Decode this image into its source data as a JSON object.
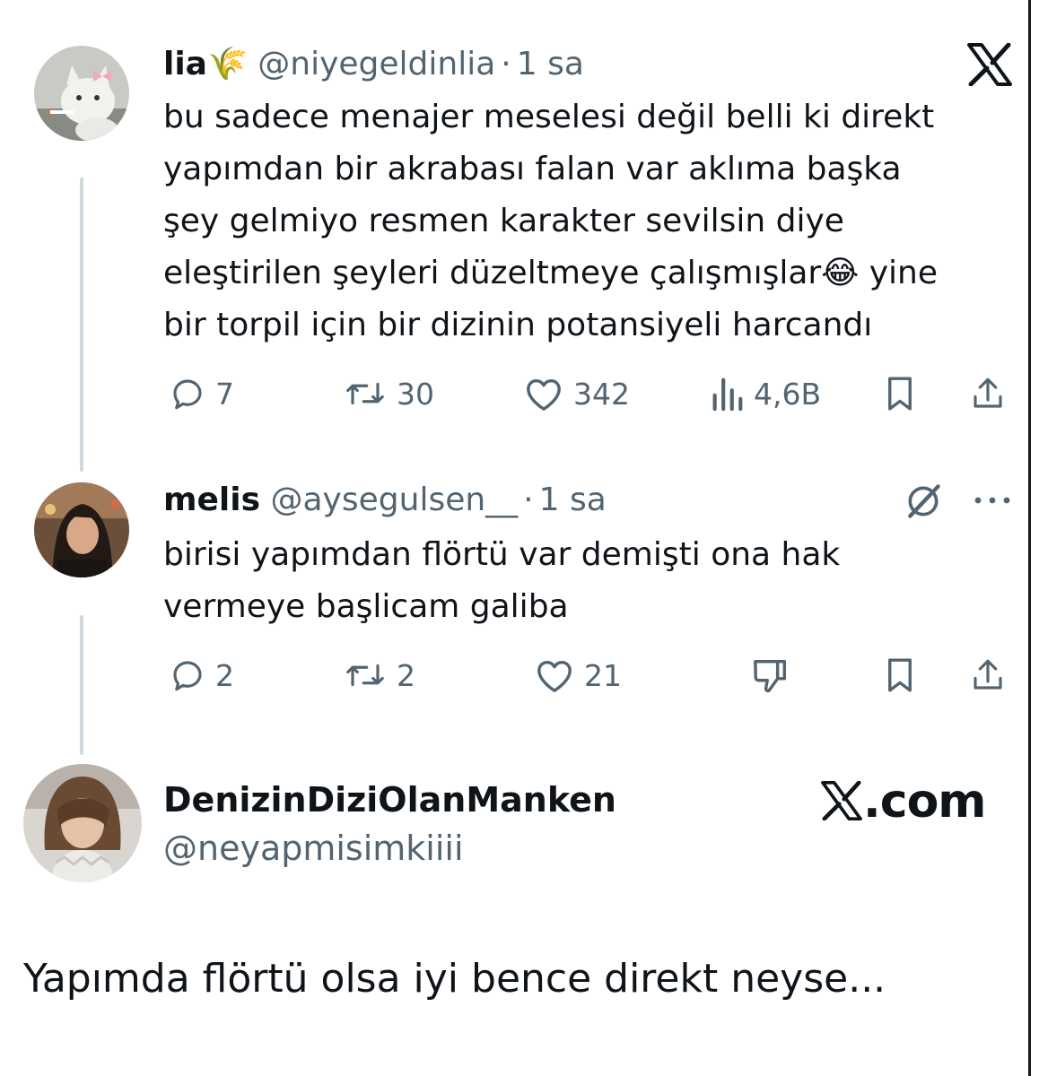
{
  "tweets": [
    {
      "name": "lia",
      "name_emoji": "🌾",
      "handle": "@niyegeldinlia",
      "separator": "·",
      "time": "1 sa",
      "text_lines": [
        "bu sadece menajer meselesi değil belli ki direkt",
        "yapımdan bir akrabası falan var aklıma başka",
        "şey gelmiyo resmen karakter sevilsin diye",
        "eleştirilen şeyleri düzeltmeye çalışmışlar😂 yine",
        "bir torpil için bir dizinin potansiyeli harcandı"
      ],
      "replies": "7",
      "retweets": "30",
      "likes": "342",
      "views": "4,6B",
      "avatar_icon": "cat-with-bow-avatar"
    },
    {
      "name": "melis",
      "handle": "@aysegulsen__",
      "separator": "·",
      "time": "1 sa",
      "text_lines": [
        "birisi yapımdan flörtü var demişti ona hak",
        "vermeye başlicam galiba"
      ],
      "replies": "2",
      "retweets": "2",
      "likes": "21",
      "avatar_icon": "woman-portrait-avatar",
      "grok_icon": "grok-icon",
      "more_icon": "more-dots-icon"
    }
  ],
  "author": {
    "name": "DenizinDiziOlanManken",
    "handle": "@neyapmisimkiiii",
    "avatar_icon": "mannequin-avatar"
  },
  "brand": {
    "logo": "x-logo",
    "site_label": ".com"
  },
  "caption": "Yapımda flörtü olsa iyi bence direkt neyse...",
  "colors": {
    "text": "#0f1419",
    "secondary": "#536471",
    "thread_line": "#cfd9de"
  }
}
